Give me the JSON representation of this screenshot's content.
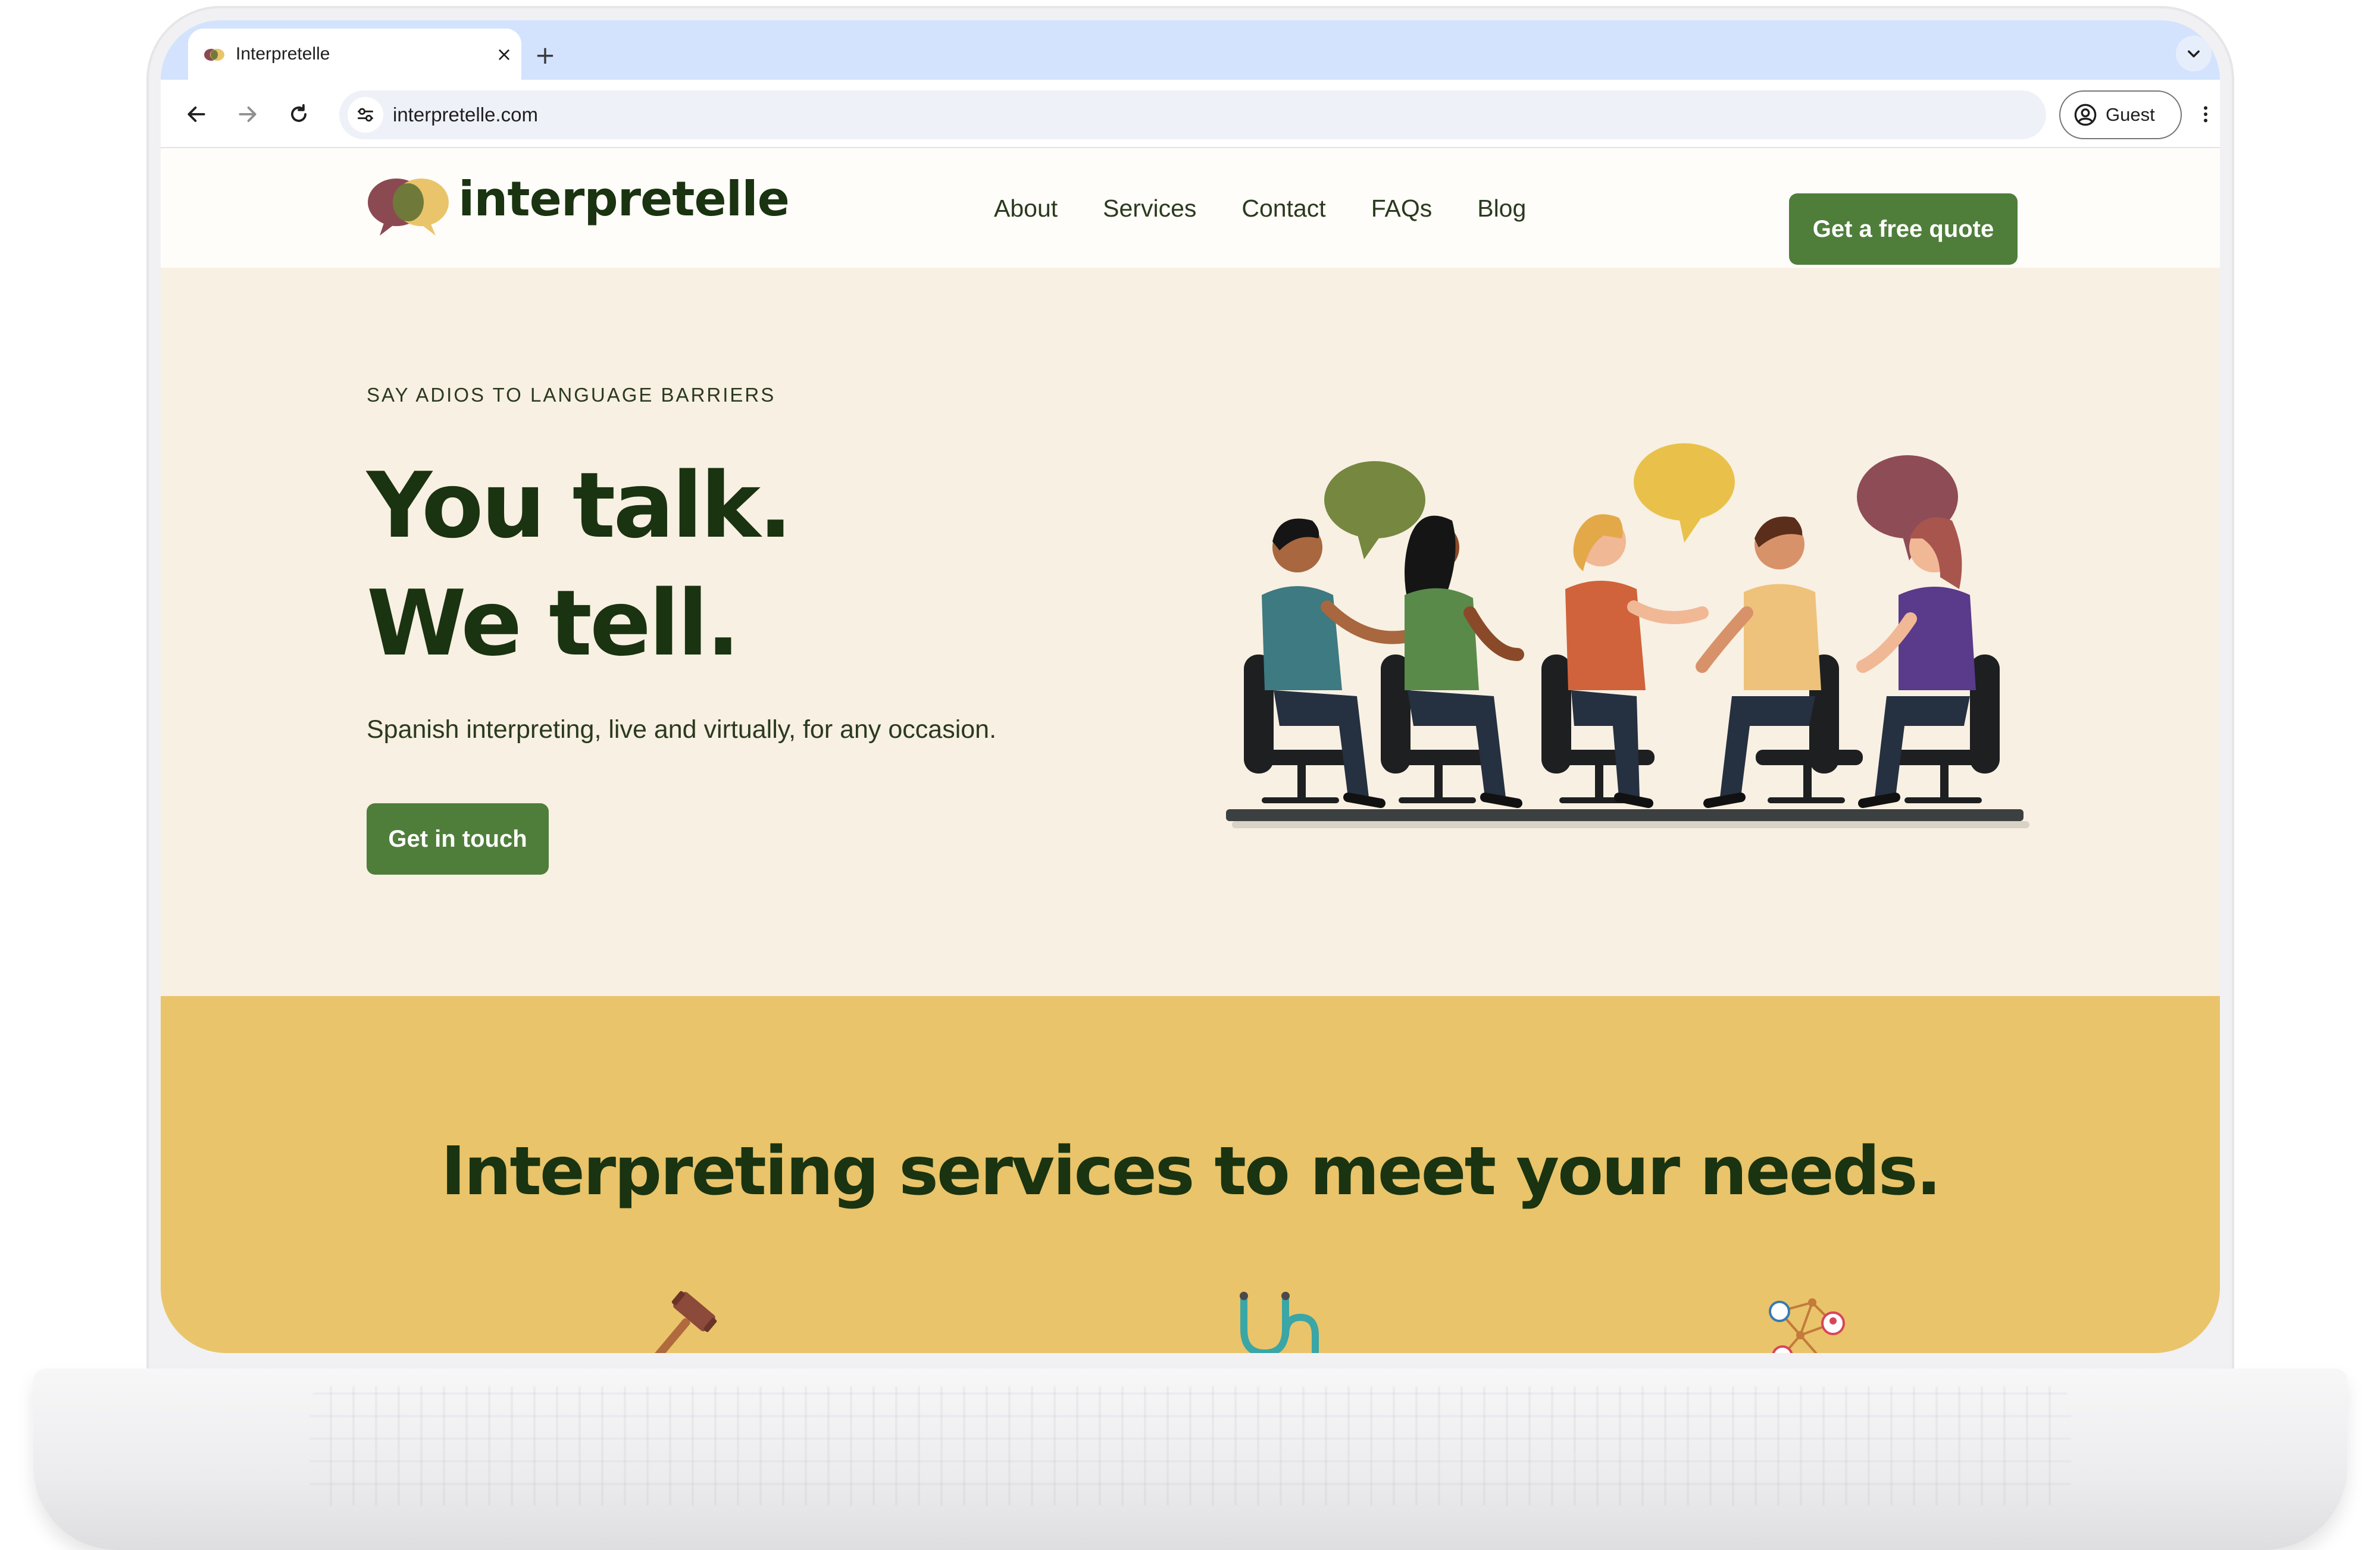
{
  "browser": {
    "tab_title": "Interpretelle",
    "close_glyph": "×",
    "new_tab_glyph": "+",
    "url": "interpretelle.com",
    "profile_label": "Guest"
  },
  "site": {
    "logo_text": "interpretelle",
    "nav": [
      {
        "label": "About"
      },
      {
        "label": "Services"
      },
      {
        "label": "Contact"
      },
      {
        "label": "FAQs"
      },
      {
        "label": "Blog"
      }
    ],
    "quote_button": "Get a free quote"
  },
  "hero": {
    "eyebrow": "SAY ADIOS TO LANGUAGE BARRIERS",
    "headline_line1": "You talk.",
    "headline_line2": "We tell.",
    "subheading": "Spanish interpreting, live and virtually, for any occasion.",
    "cta": "Get in touch",
    "illustration": "people-talking-with-speech-bubbles"
  },
  "services": {
    "title": "Interpreting services to meet your needs.",
    "icons": [
      "gavel-icon",
      "stethoscope-icon",
      "network-people-icon"
    ]
  },
  "colors": {
    "brand_green": "#4f7e3a",
    "dark_green_text": "#1a3310",
    "hero_bg": "#f8f0e3",
    "services_bg": "#e9c46a",
    "tabstrip_bg": "#d3e3fd"
  }
}
